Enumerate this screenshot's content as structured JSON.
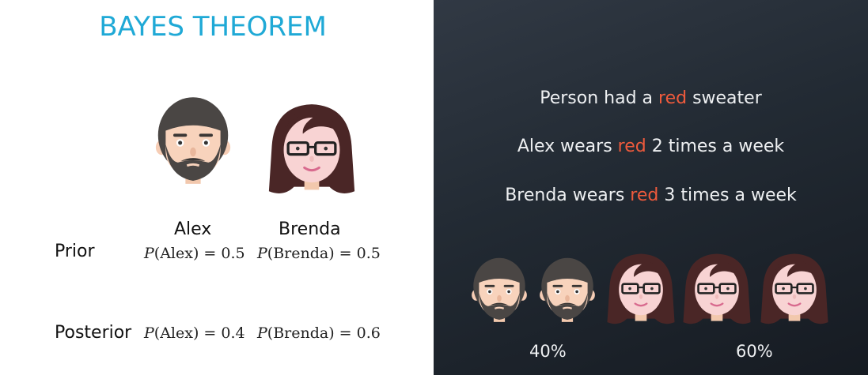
{
  "title": "BAYES THEOREM",
  "people": {
    "alex": "Alex",
    "brenda": "Brenda"
  },
  "rows": {
    "prior": "Prior",
    "posterior": "Posterior"
  },
  "prior": {
    "alex_var": "P",
    "alex_arg": "(Alex)",
    "alex_val": " = 0.5",
    "brenda_var": "P",
    "brenda_arg": "(Brenda)",
    "brenda_val": " = 0.5"
  },
  "posterior": {
    "alex_var": "P",
    "alex_arg": "(Alex)",
    "alex_val": " = 0.4",
    "brenda_var": "P",
    "brenda_arg": "(Brenda)",
    "brenda_val": " = 0.6"
  },
  "facts": [
    {
      "pre": "Person had a ",
      "hl": "red",
      "post": " sweater"
    },
    {
      "pre": "Alex wears ",
      "hl": "red",
      "post": " 2 times a week"
    },
    {
      "pre": "Brenda wears ",
      "hl": "red",
      "post": " 3 times a week"
    }
  ],
  "percent": {
    "alex": "40%",
    "brenda": "60%"
  },
  "colors": {
    "title": "#1fa9d6",
    "highlight": "#ee5a3c",
    "dark_bg": "#222a33"
  },
  "icons": {
    "alex_face": "bearded-man-face-icon",
    "brenda_face": "woman-with-glasses-face-icon"
  }
}
